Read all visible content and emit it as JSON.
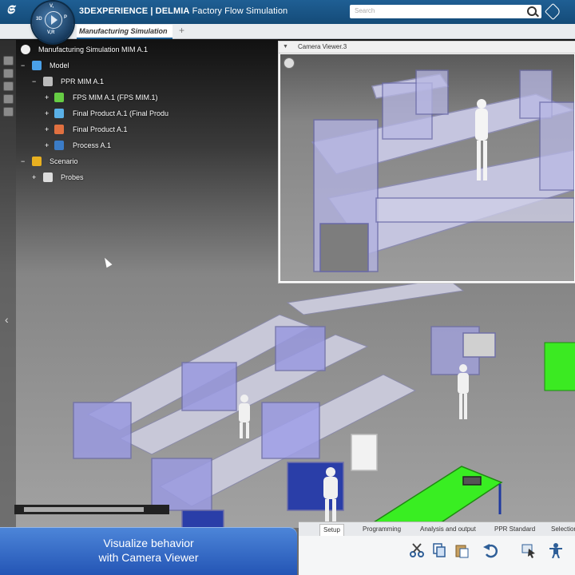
{
  "header": {
    "app_name_prefix": "3DEXPERIENCE | ",
    "app_name_brand": "DELMIA",
    "app_name_suffix": " Factory Flow Simulation",
    "search_placeholder": "Search",
    "compass": {
      "top": "V,",
      "left": "3D",
      "right": "P",
      "bottom": "V,R"
    }
  },
  "tabs": {
    "active": "Manufacturing Simulation",
    "add": "+"
  },
  "tree": {
    "root": "Manufacturing Simulation MIM A.1",
    "model": "Model",
    "ppr": "PPR MIM A.1",
    "fps": "FPS MIM A.1 (FPS MIM.1)",
    "final_product_1": "Final Product A.1 (Final Produ",
    "final_product_2": "Final Product A.1",
    "process": "Process A.1",
    "scenario": "Scenario",
    "probes": "Probes"
  },
  "camera_viewer": {
    "title": "Camera Viewer.3"
  },
  "ribbon": {
    "tabs": [
      "Setup",
      "Programming",
      "Analysis and output",
      "PPR Standard",
      "Selection"
    ]
  },
  "caption": {
    "line1": "Visualize behavior",
    "line2": "with Camera Viewer"
  },
  "colors": {
    "header": "#1f5f94",
    "caption": "#3a6fce",
    "highlight_table": "#3bea22"
  }
}
